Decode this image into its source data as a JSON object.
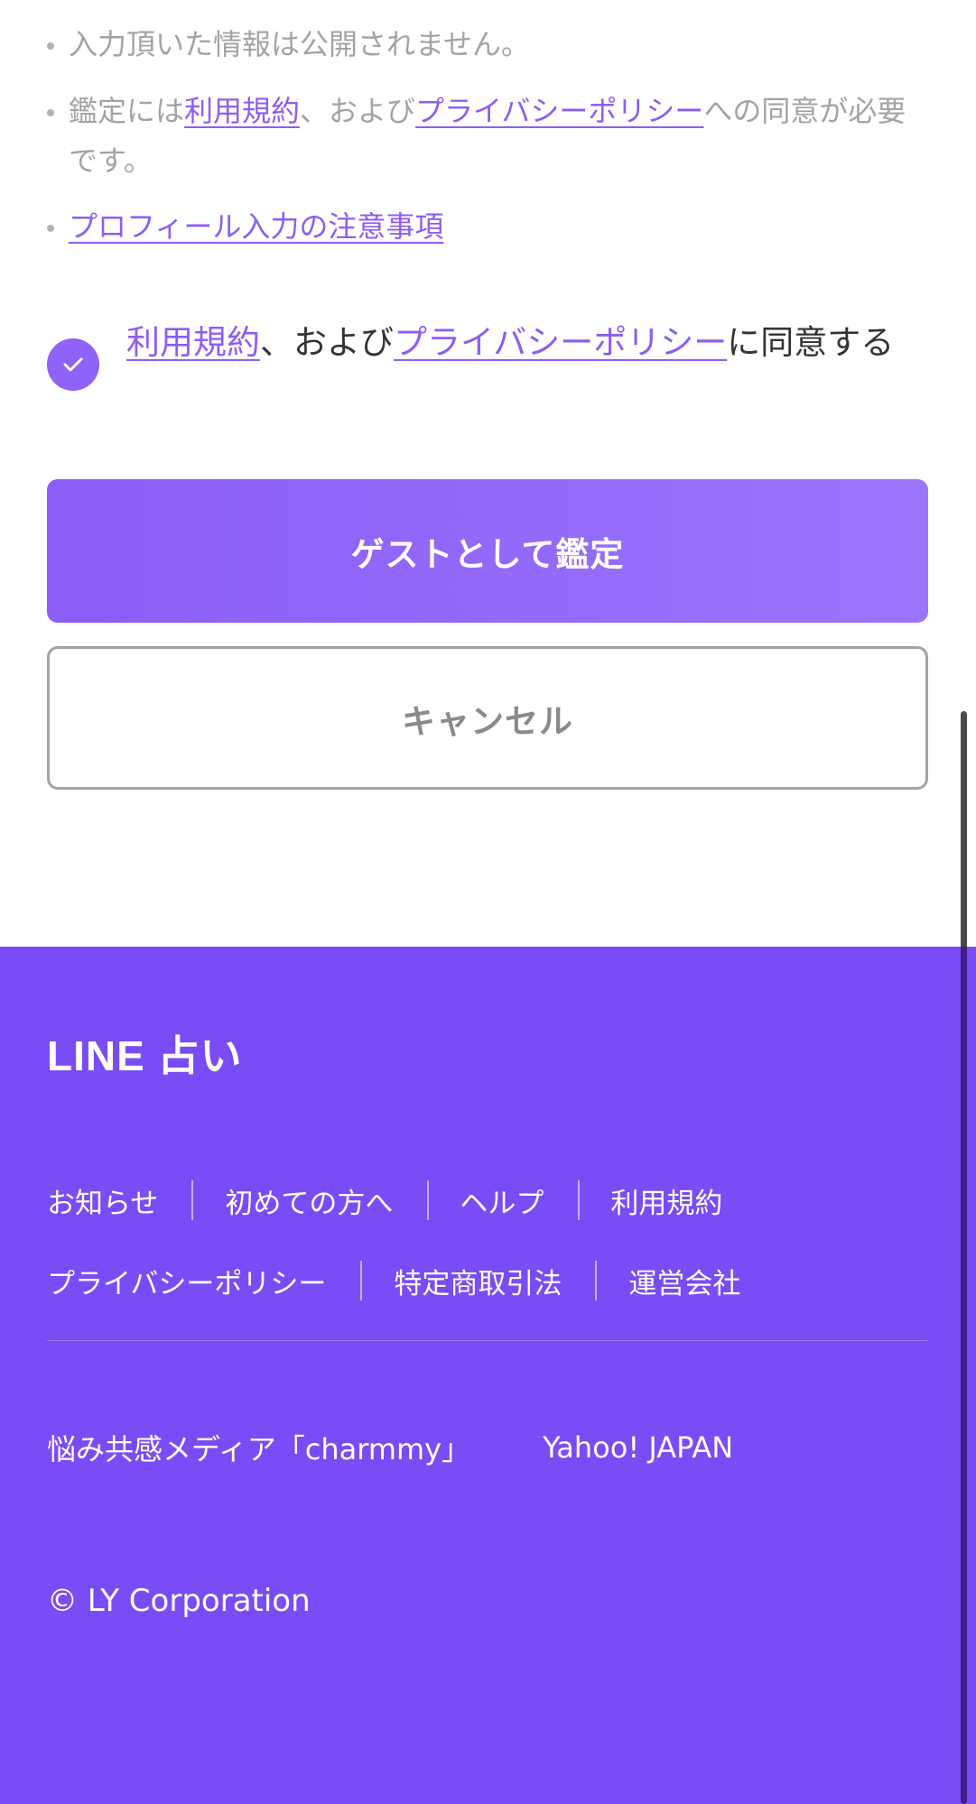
{
  "notes": {
    "item1": "入力頂いた情報は公開されません。",
    "item2": {
      "prefix": "鑑定には",
      "terms_link": "利用規約",
      "middle": "、および",
      "privacy_link": "プライバシーポリシー",
      "suffix": "への同意が必要です。"
    },
    "item3_link": "プロフィール入力の注意事項"
  },
  "agreement": {
    "checked": true,
    "terms_link": "利用規約",
    "middle": "、および",
    "privacy_link": "プライバシーポリシー",
    "suffix": "に同意する"
  },
  "buttons": {
    "guest": "ゲストとして鑑定",
    "cancel": "キャンセル"
  },
  "footer": {
    "logo": "LINE 占い",
    "links_row1": [
      "お知らせ",
      "初めての方へ",
      "ヘルプ",
      "利用規約"
    ],
    "links_row2": [
      "プライバシーポリシー",
      "特定商取引法",
      "運営会社"
    ],
    "external_links": [
      "悩み共感メディア「charmmy」",
      "Yahoo! JAPAN"
    ],
    "copyright": "© LY Corporation"
  },
  "colors": {
    "accent": "#8c5df7",
    "footer_bg": "#7a4cf6",
    "link": "#8d5cf7",
    "muted_text": "#a3a3a3"
  },
  "icons": {
    "checkbox": "check-icon"
  }
}
